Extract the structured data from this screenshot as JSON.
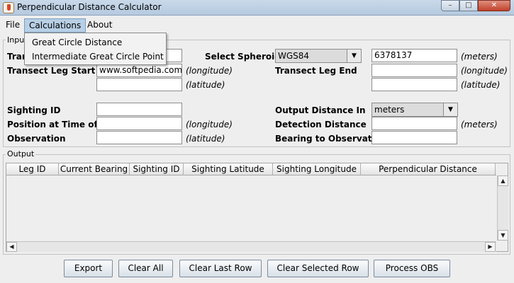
{
  "window": {
    "title": "Perpendicular Distance Calculator",
    "min_icon": "minimize-icon",
    "max_icon": "maximize-icon",
    "close_icon": "close-icon"
  },
  "menu": {
    "file": "File",
    "calculations": "Calculations",
    "about": "About"
  },
  "calculations_menu": {
    "items": [
      "Great Circle Distance",
      "Intermediate Great Circle Point"
    ]
  },
  "input_panel": {
    "title": "Input",
    "row1": {
      "label": "Tran",
      "select_spheroid_label": "Select Spheroid",
      "spheroid": "WGS84",
      "radius": "6378137",
      "radius_unit": "(meters)"
    },
    "row2": {
      "label": "Transect Leg Start",
      "start_longitude": "www.softpedia.com",
      "lon_hint": "(longitude)",
      "end_label": "Transect Leg End",
      "end_lon_hint": "(longitude)"
    },
    "row3": {
      "lat_hint": "(latitude)",
      "end_lat_hint": "(latitude)"
    },
    "sighting_id_label": "Sighting ID",
    "output_distance_label": "Output Distance In",
    "output_distance_unit": "meters",
    "position_label": "Position at Time of",
    "position_lon_hint": "(longitude)",
    "detection_distance_label": "Detection Distance",
    "detection_unit": "(meters)",
    "observation_label": "Observation",
    "observation_lat_hint": "(latitude)",
    "bearing_label": "Bearing to Observation"
  },
  "output_panel": {
    "title": "Output",
    "columns": [
      "Leg ID",
      "Current Bearing",
      "Sighting ID",
      "Sighting Latitude",
      "Sighting Longitude",
      "Perpendicular Distance"
    ]
  },
  "buttons": {
    "export": "Export",
    "clear_all": "Clear All",
    "clear_last_row": "Clear Last Row",
    "clear_selected_row": "Clear Selected Row",
    "process_obs": "Process OBS"
  }
}
